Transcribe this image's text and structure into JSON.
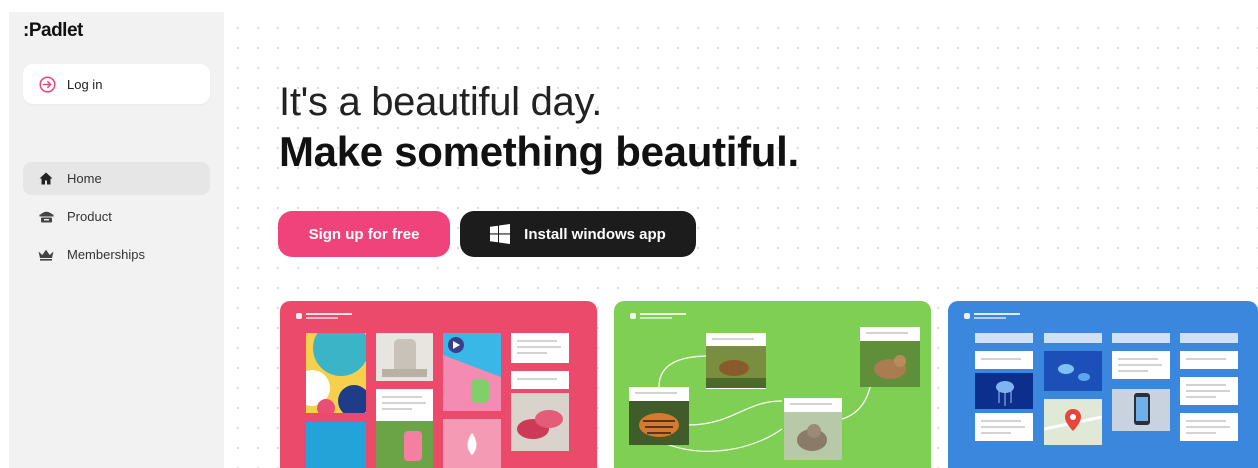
{
  "sidebar": {
    "logo": ":Padlet",
    "login_label": "Log in",
    "nav": [
      {
        "label": "Home",
        "icon": "home-icon",
        "active": true
      },
      {
        "label": "Product",
        "icon": "product-icon",
        "active": false
      },
      {
        "label": "Memberships",
        "icon": "crown-icon",
        "active": false
      }
    ]
  },
  "hero": {
    "line1": "It's a beautiful day.",
    "line2": "Make something beautiful.",
    "signup_label": "Sign up for free",
    "install_label": "Install windows app"
  },
  "colors": {
    "accent_pink": "#f0437c",
    "dark_button": "#1c1c1c",
    "board_pink": "#ec4a6b",
    "board_green": "#7fcf55",
    "board_blue": "#3b87dd"
  }
}
